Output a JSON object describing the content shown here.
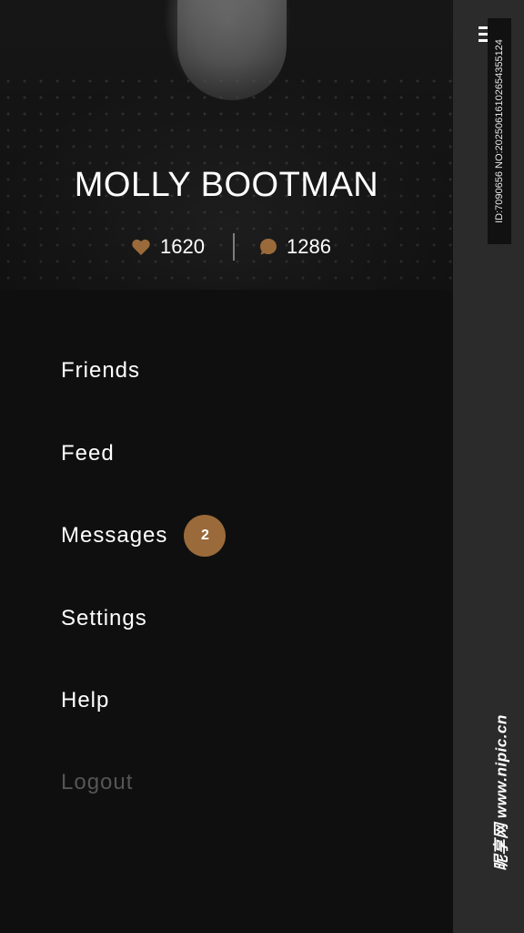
{
  "profile": {
    "name": "MOLLY BOOTMAN",
    "likes": "1620",
    "comments": "1286"
  },
  "menu": {
    "items": [
      {
        "label": "Friends"
      },
      {
        "label": "Feed"
      },
      {
        "label": "Messages",
        "badge": "2"
      },
      {
        "label": "Settings"
      },
      {
        "label": "Help"
      },
      {
        "label": "Logout"
      }
    ]
  },
  "icons": {
    "likes": "heart-icon",
    "comments": "chat-bubble-icon",
    "toggle": "menu-lines-icon"
  },
  "colors": {
    "accent": "#9a6a3a",
    "drawer_bg": "#0f0f0f",
    "side_bg": "#2b2b2b",
    "logout_text": "#555555"
  },
  "watermark": {
    "id_text": "ID:7090656 NO:20250616102654355124",
    "site_text": "昵享网 www.nipic.cn"
  }
}
